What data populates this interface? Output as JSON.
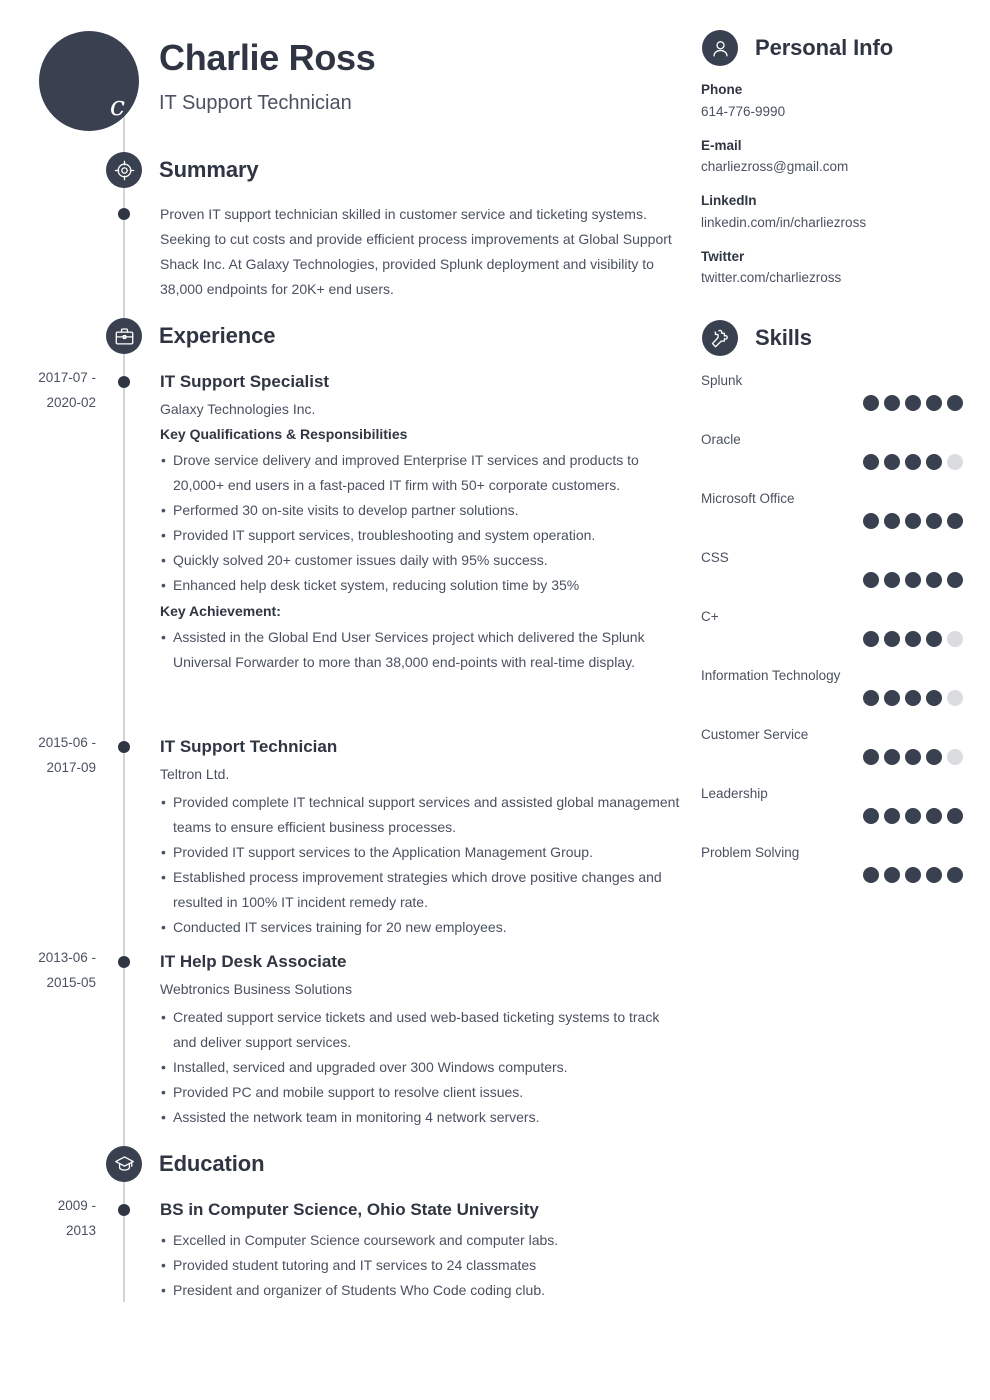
{
  "theme": {
    "dark": "#39404f",
    "text": "#4a5160",
    "heading": "#2f3542",
    "rail": "#d2d4d8",
    "dot_empty": "#dadcdf"
  },
  "header": {
    "avatar_letter": "c",
    "name": "Charlie Ross",
    "job_title": "IT Support Technician"
  },
  "summary": {
    "heading": "Summary",
    "icon": "target-icon",
    "text": "Proven IT support technician skilled in customer service and ticketing systems. Seeking to cut costs and provide efficient process improvements at Global Support Shack Inc. At Galaxy Technologies, provided Splunk deployment and visibility to 38,000 endpoints for 20K+ end users."
  },
  "experience": {
    "heading": "Experience",
    "icon": "briefcase-icon",
    "entries": [
      {
        "date_line1": "2017-07 -",
        "date_line2": "2020-02",
        "title": "IT Support Specialist",
        "org": "Galaxy Technologies Inc.",
        "sub1": "Key Qualifications & Responsibilities",
        "bullets1": [
          "Drove service delivery and improved Enterprise IT services and products to 20,000+ end users in a fast-paced IT firm with 50+ corporate customers.",
          "Performed 30 on-site visits to develop partner solutions.",
          "Provided IT support services, troubleshooting and system operation.",
          "Quickly solved 20+ customer issues daily with 95% success.",
          "Enhanced help desk ticket system, reducing solution time by 35%"
        ],
        "sub2": "Key Achievement:",
        "bullets2": [
          "Assisted in the Global End User Services project which delivered the Splunk Universal Forwarder to more than 38,000 end-points with real-time display."
        ]
      },
      {
        "date_line1": "2015-06 -",
        "date_line2": "2017-09",
        "title": "IT Support Technician",
        "org": "Teltron Ltd.",
        "bullets1": [
          "Provided complete IT technical support services and assisted global management teams to ensure efficient business processes.",
          "Provided IT support services to the Application Management Group.",
          "Established process improvement strategies which drove positive changes and resulted in 100% IT incident remedy rate.",
          "Conducted IT services training for 20 new employees."
        ]
      },
      {
        "date_line1": "2013-06 -",
        "date_line2": "2015-05",
        "title": "IT Help Desk Associate",
        "org": "Webtronics Business Solutions",
        "bullets1": [
          "Created support service tickets and used web-based ticketing systems to track and deliver support services.",
          "Installed, serviced and upgraded over 300 Windows computers.",
          "Provided PC and mobile support to resolve client issues.",
          "Assisted the network team in monitoring 4 network servers."
        ]
      }
    ]
  },
  "education": {
    "heading": "Education",
    "icon": "graduation-cap-icon",
    "entries": [
      {
        "date_line1": "2009 -",
        "date_line2": "2013",
        "title": "BS in Computer Science, Ohio State University",
        "bullets1": [
          "Excelled in Computer Science coursework and computer labs.",
          "Provided student tutoring and IT services to 24 classmates",
          "President and organizer of Students Who Code coding club."
        ]
      }
    ]
  },
  "personal_info": {
    "heading": "Personal Info",
    "icon": "person-icon",
    "items": [
      {
        "label": "Phone",
        "value": "614-776-9990"
      },
      {
        "label": "E-mail",
        "value": "charliezross@gmail.com"
      },
      {
        "label": "LinkedIn",
        "value": "linkedin.com/in/charliezross"
      },
      {
        "label": "Twitter",
        "value": "twitter.com/charliezross"
      }
    ]
  },
  "skills": {
    "heading": "Skills",
    "icon": "puzzle-piece-icon",
    "max_rating": 5,
    "items": [
      {
        "name": "Splunk",
        "rating": 5
      },
      {
        "name": "Oracle",
        "rating": 4
      },
      {
        "name": "Microsoft Office",
        "rating": 5
      },
      {
        "name": "CSS",
        "rating": 5
      },
      {
        "name": "C+",
        "rating": 4
      },
      {
        "name": "Information Technology",
        "rating": 4
      },
      {
        "name": "Customer Service",
        "rating": 4
      },
      {
        "name": "Leadership",
        "rating": 5
      },
      {
        "name": "Problem Solving",
        "rating": 5
      }
    ]
  }
}
